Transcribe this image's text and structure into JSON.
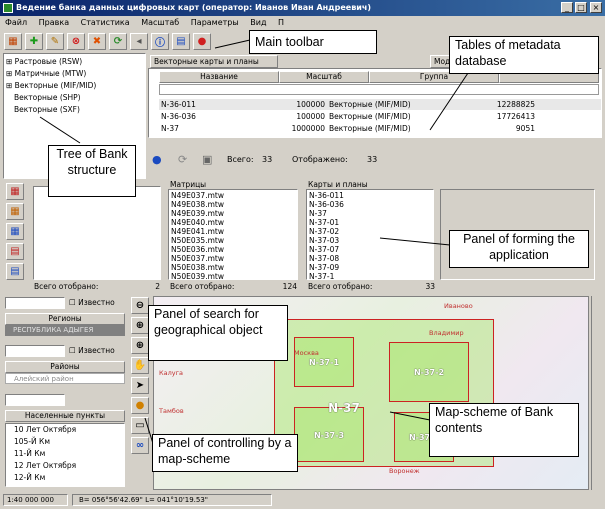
{
  "window": {
    "title": "Ведение банка данных цифровых карт (оператор: Иванов Иван Андреевич)"
  },
  "menu": [
    "Файл",
    "Правка",
    "Статистика",
    "Масштаб",
    "Параметры",
    "Вид",
    "П"
  ],
  "toolbar": {
    "icons": [
      "grid-icon",
      "add-icon",
      "edit-icon",
      "delete-icon",
      "cross-icon",
      "refresh-icon",
      "info-icon",
      "doc-icon",
      "stop-icon"
    ]
  },
  "tree": {
    "items": [
      "Растровые (RSW)",
      "Матричные (MTW)",
      "Векторные (MIF/MID)",
      "Векторные (SHP)",
      "Векторные (SXF)"
    ]
  },
  "tabs": [
    "Векторные карты и планы",
    "Модели местности"
  ],
  "table": {
    "headers": [
      "Название",
      "Масштаб",
      "Группа"
    ],
    "rows": [
      [
        "N-36-011",
        "100000",
        "Векторные (MIF/MID)",
        "12288825"
      ],
      [
        "N-36-036",
        "100000",
        "Векторные (MIF/MID)",
        "17726413"
      ],
      [
        "N-37",
        "1000000",
        "Векторные (MIF/MID)",
        "9051"
      ]
    ],
    "footer": {
      "total_label": "Всего:",
      "total": "33",
      "shown_label": "Отображено:",
      "shown": "33"
    }
  },
  "panels": {
    "left_total": "Всего отобрано:",
    "left_total_val": "2",
    "matrices_title": "Матрицы",
    "matrices": [
      "N49E037.mtw",
      "N49E038.mtw",
      "N49E039.mtw",
      "N49E040.mtw",
      "N49E041.mtw",
      "N50E035.mtw",
      "N50E036.mtw",
      "N50E037.mtw",
      "N50E038.mtw",
      "N50E039.mtw"
    ],
    "matrices_total": "Всего отобрано:",
    "matrices_total_val": "124",
    "maps_title": "Карты и планы",
    "maps": [
      "N-36-011",
      "N-36-036",
      "N-37",
      "N-37-01",
      "N-37-02",
      "N-37-03",
      "N-37-07",
      "N-37-08",
      "N-37-09",
      "N-37-1"
    ],
    "maps_total": "Всего отобрано:",
    "maps_total_val": "33"
  },
  "search": {
    "known": "Известно",
    "regions": "Регионы",
    "region_value": "РЕСПУБЛИКА АДЫГЕЯ",
    "districts": "Районы",
    "district_value": "Алейский район",
    "settlements": "Населенные пункты",
    "settlement_list": [
      "10 Лет Октября",
      "105-Й Км",
      "11-Й Км",
      "12 Лет Октября",
      "12-Й Км"
    ]
  },
  "map": {
    "cells": [
      "N-37-1",
      "N-37-2",
      "N-37-3",
      "N-37",
      "N-37-4"
    ],
    "places": [
      "Иваново",
      "Владимир",
      "Москва",
      "Калуга",
      "Тамбов",
      "Воронеж"
    ]
  },
  "status": {
    "scale": "1:40 000 000",
    "coords": "B= 056°56'42.69\" L= 041°10'19.53\""
  },
  "callouts": {
    "toolbar": "Main toolbar",
    "tables": "Tables of metadata database",
    "tree": "Tree of Bank structure",
    "forming": "Panel of forming the application",
    "search": "Panel of search for geographical object",
    "control": "Panel of controlling by a map-scheme",
    "mapscheme": "Map-scheme of Bank contents"
  }
}
